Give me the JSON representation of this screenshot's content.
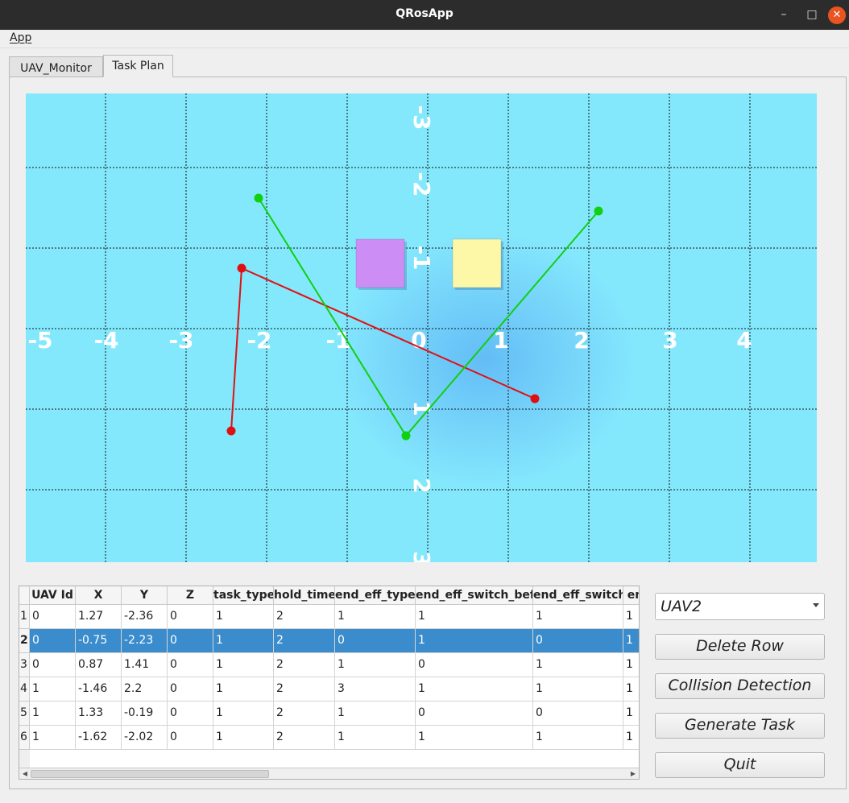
{
  "window": {
    "title": "QRosApp",
    "min": "–",
    "max": "□",
    "close": "✕"
  },
  "menu": {
    "app": "App"
  },
  "tabs": [
    {
      "label": "UAV_Monitor"
    },
    {
      "label": "Task Plan"
    }
  ],
  "scene": {
    "x_axis_labels": [
      "-5",
      "-4",
      "-3",
      "-2",
      "-1",
      "0",
      "1",
      "2",
      "3",
      "4"
    ],
    "y_axis_labels": [
      "-3",
      "-2",
      "-1",
      "1",
      "2",
      "3"
    ],
    "boxes": [
      {
        "color": "#cc8ef5"
      },
      {
        "color": "#fdf8a8"
      }
    ],
    "paths": [
      {
        "color": "#e01010",
        "points": [
          [
            -2.36,
            1.27
          ],
          [
            -2.23,
            -0.75
          ],
          [
            1.41,
            0.87
          ]
        ]
      },
      {
        "color": "#10d010",
        "points": [
          [
            2.2,
            -1.46
          ],
          [
            -0.19,
            1.33
          ],
          [
            -2.02,
            -1.62
          ]
        ]
      }
    ]
  },
  "table": {
    "headers": [
      "UAV Id",
      "X",
      "Y",
      "Z",
      "task_type",
      "hold_time",
      "end_eff_type",
      "end_eff_switch_bef",
      "end_eff_switch",
      "en"
    ],
    "row_numbers": [
      "1",
      "2",
      "3",
      "4",
      "5",
      "6"
    ],
    "selected_row": 1,
    "rows": [
      [
        "0",
        "1.27",
        "-2.36",
        "0",
        "1",
        "2",
        "1",
        "1",
        "1",
        "1"
      ],
      [
        "0",
        "-0.75",
        "-2.23",
        "0",
        "1",
        "2",
        "0",
        "1",
        "0",
        "1"
      ],
      [
        "0",
        "0.87",
        "1.41",
        "0",
        "1",
        "2",
        "1",
        "0",
        "1",
        "1"
      ],
      [
        "1",
        "-1.46",
        "2.2",
        "0",
        "1",
        "2",
        "3",
        "1",
        "1",
        "1"
      ],
      [
        "1",
        "1.33",
        "-0.19",
        "0",
        "1",
        "2",
        "1",
        "0",
        "0",
        "1"
      ],
      [
        "1",
        "-1.62",
        "-2.02",
        "0",
        "1",
        "2",
        "1",
        "1",
        "1",
        "1"
      ]
    ]
  },
  "controls": {
    "uav_select": "UAV2",
    "delete_row": "Delete Row",
    "collision_detection": "Collision Detection",
    "generate_task": "Generate Task",
    "quit": "Quit"
  }
}
